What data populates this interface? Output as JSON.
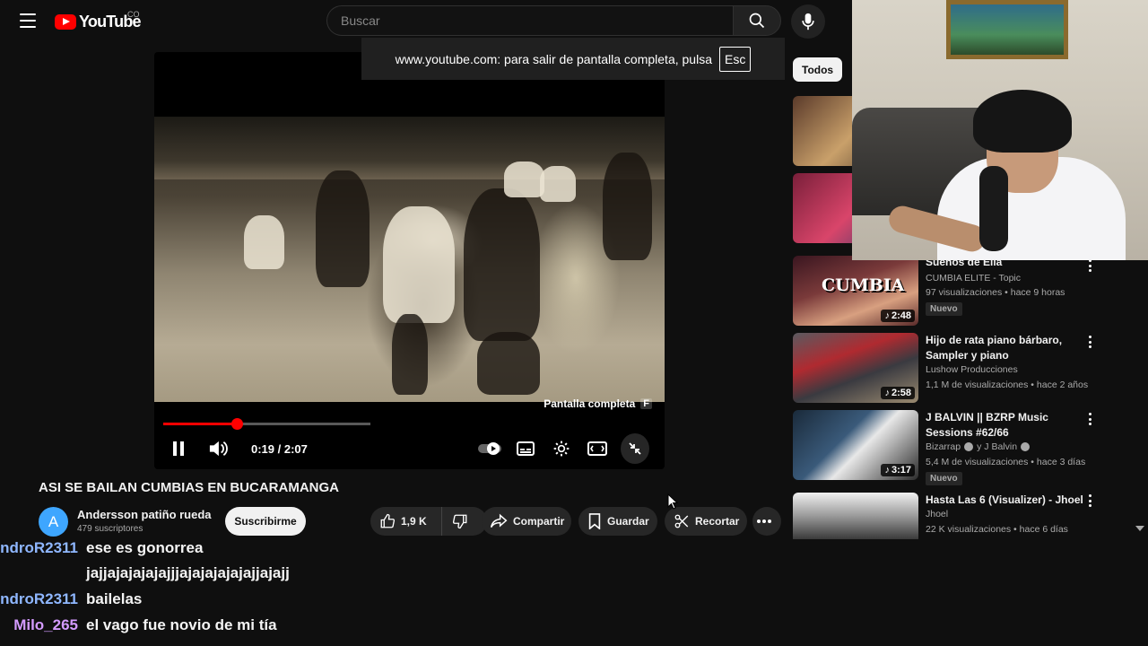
{
  "header": {
    "logo_text": "YouTube",
    "country_code": "CO",
    "search_placeholder": "Buscar"
  },
  "fullscreen_notice": {
    "text": "www.youtube.com: para salir de pantalla completa, pulsa",
    "key": "Esc"
  },
  "player": {
    "tooltip_label": "Pantalla completa",
    "tooltip_key": "F",
    "time": "0:19 / 2:07",
    "progress_fraction": 0.15,
    "buffered_fraction": 0.42
  },
  "video": {
    "title": "ASI SE BAILAN CUMBIAS EN BUCARAMANGA",
    "channel_initial": "A",
    "channel_name": "Andersson patiño rueda",
    "subscribers": "479 suscriptores",
    "subscribe_label": "Suscribirme",
    "likes": "1,9 K",
    "share_label": "Compartir",
    "save_label": "Guardar",
    "clip_label": "Recortar"
  },
  "chat": [
    {
      "user": "ndroR2311",
      "message": "ese es gonorrea",
      "user_color": "#8fb7ff"
    },
    {
      "user": "",
      "message": "jajjajajajajajjjajajajajajajjajajj",
      "user_color": "#8fb7ff"
    },
    {
      "user": "ndroR2311",
      "message": "bailelas",
      "user_color": "#8fb7ff"
    },
    {
      "user": "Milo_265",
      "message": "el vago fue novio de mi tía",
      "user_color": "#d49bff"
    }
  ],
  "sidebar": {
    "chip_all": "Todos",
    "videos": [
      {
        "title": "Sueños de Ella",
        "channel": "CUMBIA ELITE - Topic",
        "meta": "97 visualizaciones • hace 9 horas",
        "duration": "2:48",
        "badge": "Nuevo",
        "thumb_text": "CUMBIA"
      },
      {
        "title": "Hijo de rata piano bárbaro, Sampler y piano",
        "channel": "Lushow Producciones",
        "meta": "1,1 M de visualizaciones • hace 2 años",
        "duration": "2:58",
        "badge": ""
      },
      {
        "title": "J BALVIN || BZRP Music Sessions #62/66",
        "channel": "Bizarrap",
        "channel_suffix": "y J Balvin",
        "meta": "5,4 M de visualizaciones • hace 3 días",
        "duration": "3:17",
        "badge": "Nuevo"
      },
      {
        "title": "Hasta Las 6 (Visualizer) - Jhoel",
        "channel": "Jhoel",
        "meta": "22 K visualizaciones • hace 6 días",
        "duration": "",
        "badge": ""
      }
    ]
  },
  "colors": {
    "accent_red": "#ff0000",
    "background": "#0f0f0f",
    "pill": "#272727"
  }
}
